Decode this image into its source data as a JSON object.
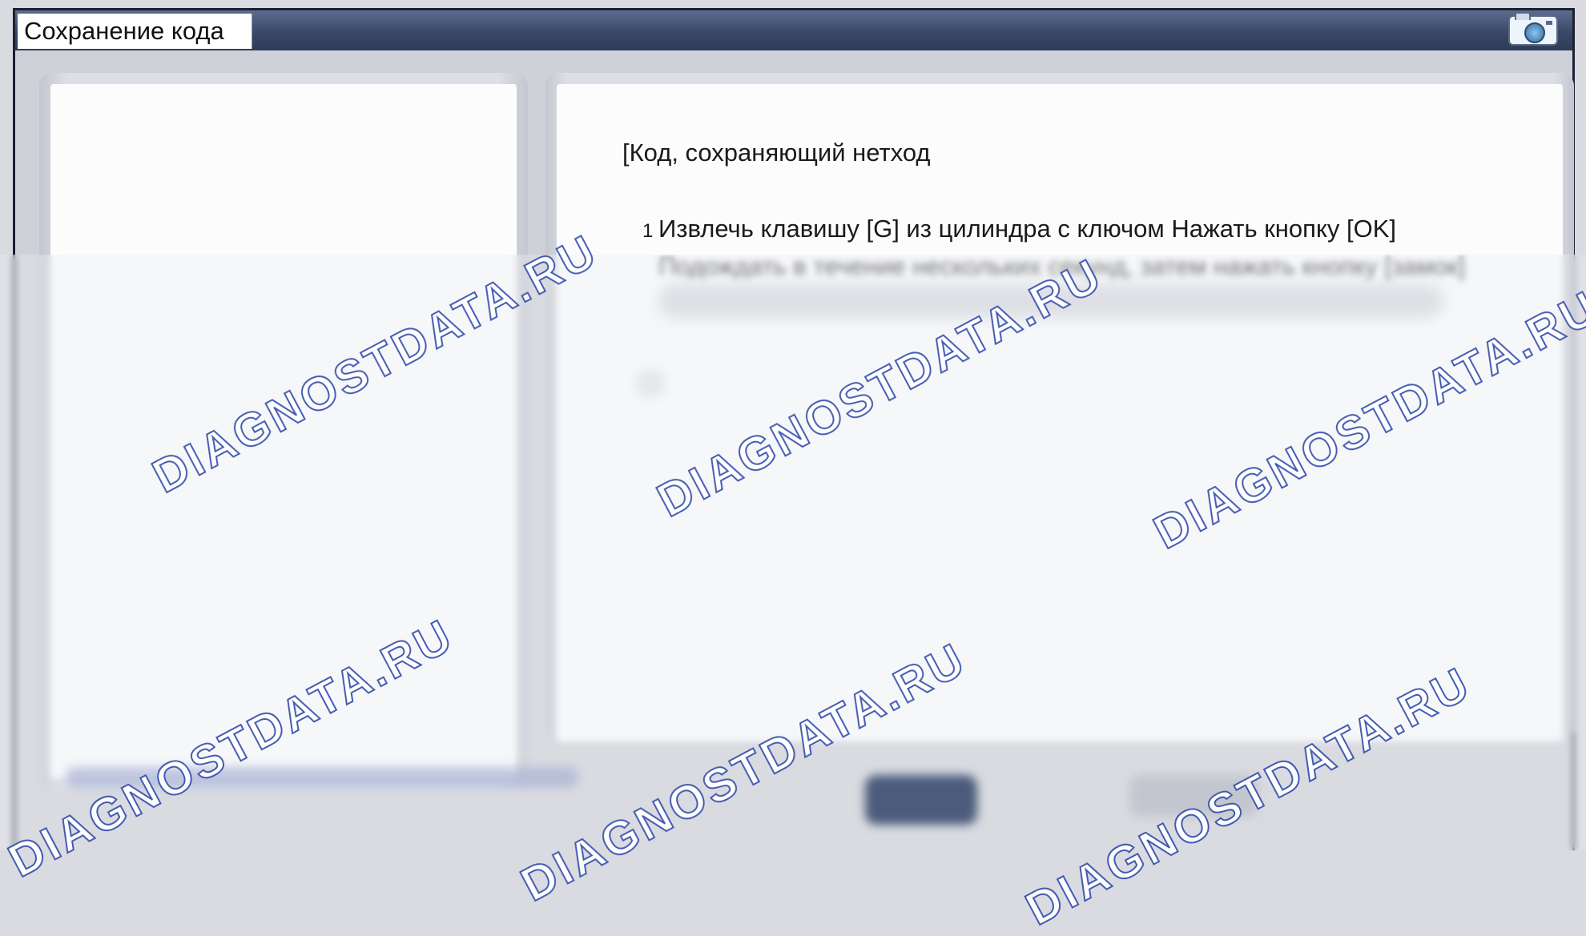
{
  "window": {
    "title": "Сохранение кода",
    "camera_icon": "camera-icon"
  },
  "content": {
    "heading": "[Код, сохраняющий нетход",
    "steps": [
      {
        "number": "1",
        "text": "Извлечь клавишу [G] из цилиндра с ключом Нажать кнопку [OK]"
      },
      {
        "number": "",
        "text": "Подождать в течение нескольких секунд, затем нажать кнопку [замок]"
      }
    ]
  },
  "watermarks": {
    "primary": "DIAGNOSTDATA.RU"
  },
  "colors": {
    "titlebar": "#3a4866",
    "watermark_outline": "#3c54b0",
    "panel_bg": "#fcfcfd"
  }
}
